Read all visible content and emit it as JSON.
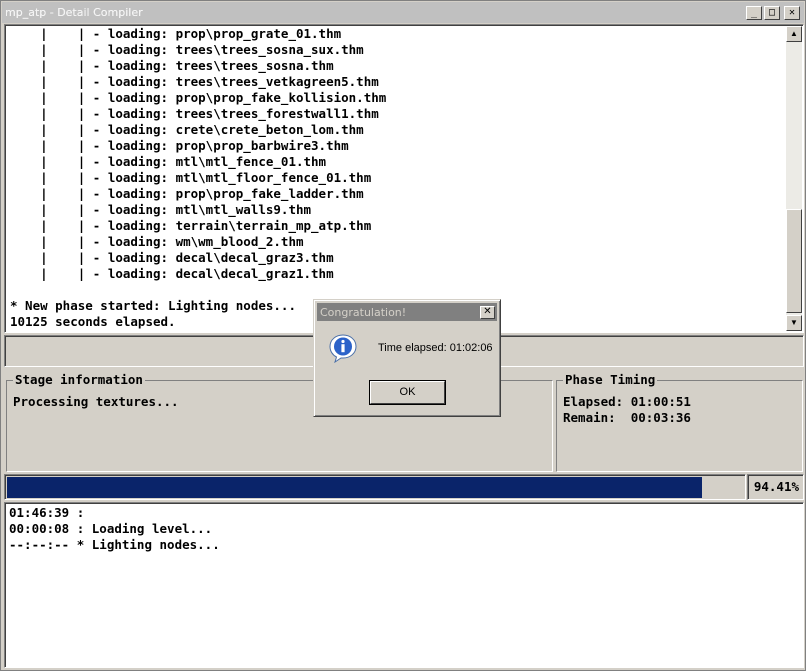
{
  "window": {
    "title": "mp_atp - Detail Compiler",
    "controls": {
      "minimize": "_",
      "maximize": "□",
      "close": "✕"
    }
  },
  "log": {
    "lines": [
      "    |    | - loading: prop\\prop_grate_01.thm",
      "    |    | - loading: trees\\trees_sosna_sux.thm",
      "    |    | - loading: trees\\trees_sosna.thm",
      "    |    | - loading: trees\\trees_vetkagreen5.thm",
      "    |    | - loading: prop\\prop_fake_kollision.thm",
      "    |    | - loading: trees\\trees_forestwall1.thm",
      "    |    | - loading: crete\\crete_beton_lom.thm",
      "    |    | - loading: prop\\prop_barbwire3.thm",
      "    |    | - loading: mtl\\mtl_fence_01.thm",
      "    |    | - loading: mtl\\mtl_floor_fence_01.thm",
      "    |    | - loading: prop\\prop_fake_ladder.thm",
      "    |    | - loading: mtl\\mtl_walls9.thm",
      "    |    | - loading: terrain\\terrain_mp_atp.thm",
      "    |    | - loading: wm\\wm_blood_2.thm",
      "    |    | - loading: decal\\decal_graz3.thm",
      "    |    | - loading: decal\\decal_graz1.thm",
      "",
      "* New phase started: Lighting nodes...",
      "10125 seconds elapsed."
    ]
  },
  "stage": {
    "legend": "Stage information",
    "text": "Processing textures..."
  },
  "timing": {
    "legend": "Phase Timing",
    "elapsed": "Elapsed: 01:00:51",
    "remain": "Remain:  00:03:36"
  },
  "progress": {
    "fraction": 0.9441,
    "label": "94.41%",
    "fill_color": "#0a246a"
  },
  "history": {
    "lines": [
      "01:46:39 :",
      "00:00:08 : Loading level...",
      "--:--:-- * Lighting nodes..."
    ]
  },
  "dialog": {
    "title": "Congratulation!",
    "icon": "info-icon",
    "message": "Time elapsed: 01:02:06",
    "ok_label": "OK",
    "close_label": "✕"
  }
}
